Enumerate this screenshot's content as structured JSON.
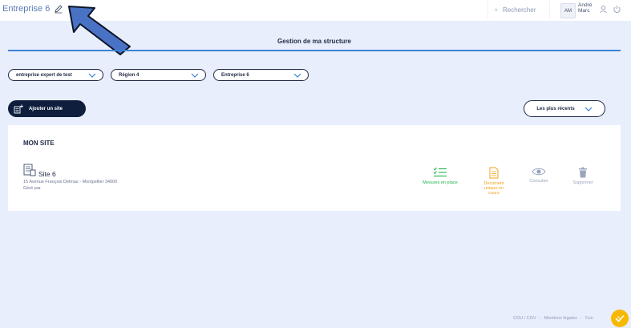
{
  "header": {
    "company_name": "Entreprise 6",
    "search_placeholder": "Rechercher",
    "avatar_initials": "AM",
    "user_first_name": "André",
    "user_last_name": "Marc"
  },
  "page": {
    "title": "Gestion de ma structure"
  },
  "filters": [
    {
      "label": "entreprise expert de test"
    },
    {
      "label": "Région 4"
    },
    {
      "label": "Entreprise 6"
    }
  ],
  "toolbar": {
    "add_site_label": "Ajouter un site",
    "sort_label": "Les plus récents"
  },
  "site_card": {
    "heading": "MON SITE",
    "site_name": "Site 6",
    "address": "15 Avenue François Delmas - Montpellier 34000",
    "managed_by": "Géré par",
    "actions": {
      "measures": "Mesures en place",
      "document": "Document unique en cours",
      "consult": "Consulter",
      "delete": "Supprimer"
    }
  },
  "footer": {
    "cgu": "CGU / CGV",
    "legal": "Mentions légales",
    "contact": "Con"
  },
  "colors": {
    "background": "#e8eefc",
    "navy": "#0f1e3d",
    "accent_blue": "#3b82d6",
    "green": "#22b24c",
    "orange": "#f2a31b",
    "gray": "#9aa6bf",
    "arrow_fill": "#4a72c4"
  }
}
